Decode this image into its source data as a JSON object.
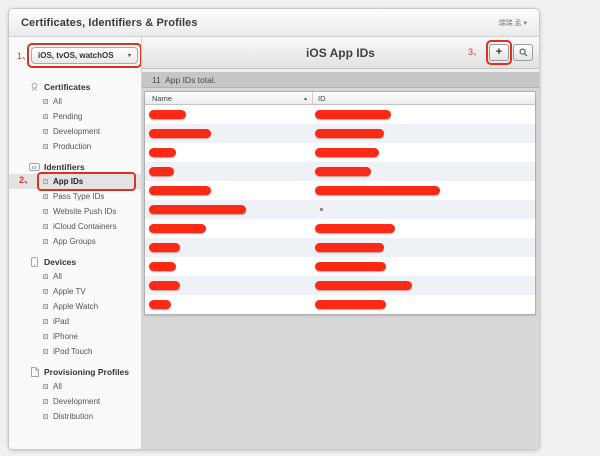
{
  "header": {
    "title": "Certificates, Identifiers & Profiles",
    "user_menu": "瑞瑞 孟 ▾"
  },
  "annotations": [
    {
      "label": "1、",
      "target": "platform-dropdown"
    },
    {
      "label": "2、",
      "target": "sidebar-item-app-ids"
    },
    {
      "label": "3、",
      "target": "add-app-id-button"
    }
  ],
  "sidebar": {
    "platform_dropdown": {
      "value": "iOS, tvOS, watchOS",
      "caret": "▾"
    },
    "sections": [
      {
        "label": "Certificates",
        "icon": "certificate-icon",
        "items": [
          {
            "label": "All"
          },
          {
            "label": "Pending"
          },
          {
            "label": "Development"
          },
          {
            "label": "Production"
          }
        ]
      },
      {
        "label": "Identifiers",
        "icon": "id-badge-icon",
        "items": [
          {
            "label": "App IDs",
            "selected": true
          },
          {
            "label": "Pass Type IDs"
          },
          {
            "label": "Website Push IDs"
          },
          {
            "label": "iCloud Containers"
          },
          {
            "label": "App Groups"
          }
        ]
      },
      {
        "label": "Devices",
        "icon": "device-icon",
        "items": [
          {
            "label": "All"
          },
          {
            "label": "Apple TV"
          },
          {
            "label": "Apple Watch"
          },
          {
            "label": "iPad"
          },
          {
            "label": "iPhone"
          },
          {
            "label": "iPod Touch"
          }
        ]
      },
      {
        "label": "Provisioning Profiles",
        "icon": "document-icon",
        "items": [
          {
            "label": "All"
          },
          {
            "label": "Development"
          },
          {
            "label": "Distribution"
          }
        ]
      }
    ]
  },
  "main": {
    "title": "iOS App IDs",
    "count_text": "11  App IDs total.",
    "toolbar": {
      "add_button_label": "+"
    },
    "table": {
      "columns": [
        "Name",
        "ID"
      ],
      "sort_indicator": "▴",
      "redacted_rows": [
        {
          "name_bar_w": 37,
          "id_bar_w": 76
        },
        {
          "name_bar_w": 62,
          "id_bar_w": 69
        },
        {
          "name_bar_w": 27,
          "id_bar_w": 64
        },
        {
          "name_bar_w": 25,
          "id_bar_w": 56
        },
        {
          "name_bar_w": 62,
          "id_bar_w": 125
        },
        {
          "name_bar_w": 97,
          "id_bar_w": 0,
          "id_tiny_mark": true
        },
        {
          "name_bar_w": 57,
          "id_bar_w": 80
        },
        {
          "name_bar_w": 31,
          "id_bar_w": 69
        },
        {
          "name_bar_w": 27,
          "id_bar_w": 71
        },
        {
          "name_bar_w": 31,
          "id_bar_w": 97
        },
        {
          "name_bar_w": 22,
          "id_bar_w": 71
        }
      ]
    }
  },
  "colors": {
    "annotation_red": "#e0301e",
    "redaction_red": "#fa2a16",
    "row_stripe": "#eef1f5",
    "count_bar_bg": "#c7c7c7"
  }
}
